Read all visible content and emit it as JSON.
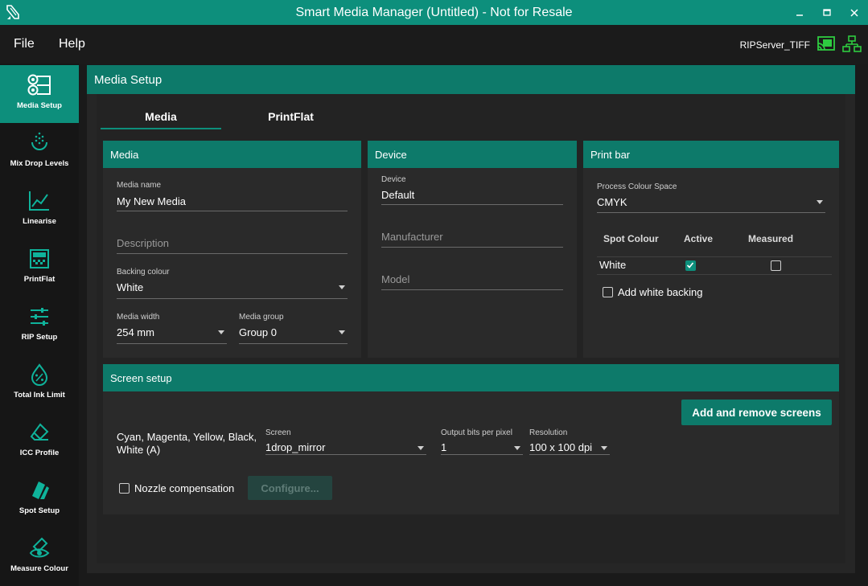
{
  "window": {
    "title": "Smart Media Manager (Untitled) - Not for Resale"
  },
  "menu": {
    "file": "File",
    "help": "Help"
  },
  "server": {
    "name": "RIPServer_TIFF"
  },
  "sidebar": {
    "items": [
      {
        "label": "Media Setup",
        "icon": "media-setup-icon",
        "active": true
      },
      {
        "label": "Mix Drop Levels",
        "icon": "drop-levels-icon"
      },
      {
        "label": "Linearise",
        "icon": "chart-line-icon"
      },
      {
        "label": "PrintFlat",
        "icon": "printflat-icon"
      },
      {
        "label": "RIP Setup",
        "icon": "sliders-icon"
      },
      {
        "label": "Total Ink Limit",
        "icon": "ink-drop-percent-icon"
      },
      {
        "label": "ICC Profile",
        "icon": "eraser-icon"
      },
      {
        "label": "Spot Setup",
        "icon": "swatches-icon"
      },
      {
        "label": "Measure Colour",
        "icon": "eye-dropper-icon"
      }
    ]
  },
  "main": {
    "title": "Media Setup",
    "tabs": [
      {
        "label": "Media",
        "active": true
      },
      {
        "label": "PrintFlat"
      }
    ]
  },
  "media": {
    "title": "Media",
    "name_label": "Media name",
    "name_value": "My New Media",
    "description_placeholder": "Description",
    "backing_label": "Backing colour",
    "backing_value": "White",
    "width_label": "Media width",
    "width_value": "254 mm",
    "group_label": "Media group",
    "group_value": "Group 0"
  },
  "device": {
    "title": "Device",
    "device_label": "Device",
    "device_value": "Default",
    "manufacturer_placeholder": "Manufacturer",
    "model_placeholder": "Model"
  },
  "printbar": {
    "title": "Print bar",
    "colour_space_label": "Process Colour Space",
    "colour_space_value": "CMYK",
    "col_spot": "Spot Colour",
    "col_active": "Active",
    "col_measured": "Measured",
    "rows": [
      {
        "name": "White",
        "active": true,
        "measured": false
      }
    ],
    "add_white_backing": "Add white backing"
  },
  "screen": {
    "title": "Screen setup",
    "add_remove_button": "Add and remove screens",
    "channels_line1": "Cyan, Magenta, Yellow, Black,",
    "channels_line2": "White (A)",
    "screen_label": "Screen",
    "screen_value": "1drop_mirror",
    "bits_label": "Output bits per pixel",
    "bits_value": "1",
    "resolution_label": "Resolution",
    "resolution_value": "100 x 100 dpi",
    "nozzle_label": "Nozzle compensation",
    "configure_button": "Configure..."
  },
  "colors": {
    "accent": "#0d8f7c",
    "header": "#0d7a6a",
    "background": "#1a1a1a",
    "panel": "#2a2a2a"
  }
}
